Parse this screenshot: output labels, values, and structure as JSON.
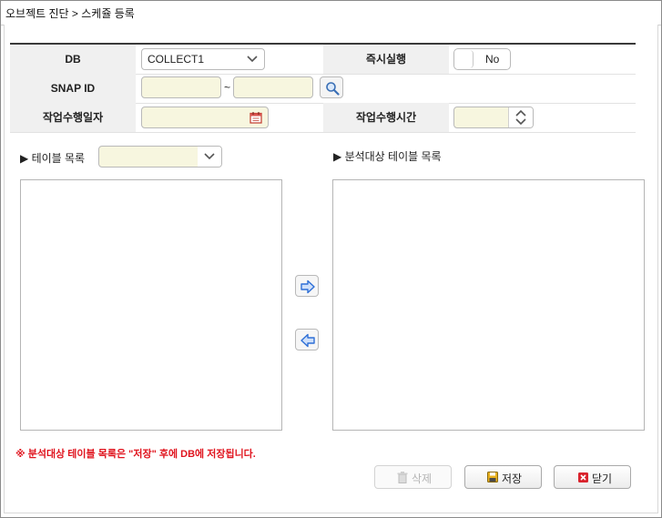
{
  "window": {
    "breadcrumb": "오브젝트 진단 > 스케쥴 등록"
  },
  "form": {
    "db_label": "DB",
    "db_value": "COLLECT1",
    "immediate_label": "즉시실행",
    "immediate_toggle": "No",
    "snap_label": "SNAP ID",
    "snap_separator": "~",
    "snap_from": "",
    "snap_to": "",
    "date_label": "작업수행일자",
    "date_value": "",
    "time_label": "작업수행시간",
    "time_value": ""
  },
  "tables": {
    "source_label": "▶ 테이블 목록",
    "source_select": "",
    "target_label": "▶ 분석대상 테이블 목록",
    "source_items": [],
    "target_items": []
  },
  "notice": "※ 분석대상 테이블 목록은 \"저장\" 후에 DB에 저장됩니다.",
  "buttons": {
    "delete": "삭제",
    "save": "저장",
    "close": "닫기"
  },
  "icons": {
    "search": "search-icon",
    "calendar": "calendar-icon",
    "move_right": "arrow-right-icon",
    "move_left": "arrow-left-icon",
    "trash": "trash-icon",
    "floppy": "save-icon",
    "close": "close-icon"
  },
  "colors": {
    "required_field_bg": "#f7f6df",
    "notice_red": "#e0141e",
    "arrow_blue": "#2e6fd6"
  }
}
